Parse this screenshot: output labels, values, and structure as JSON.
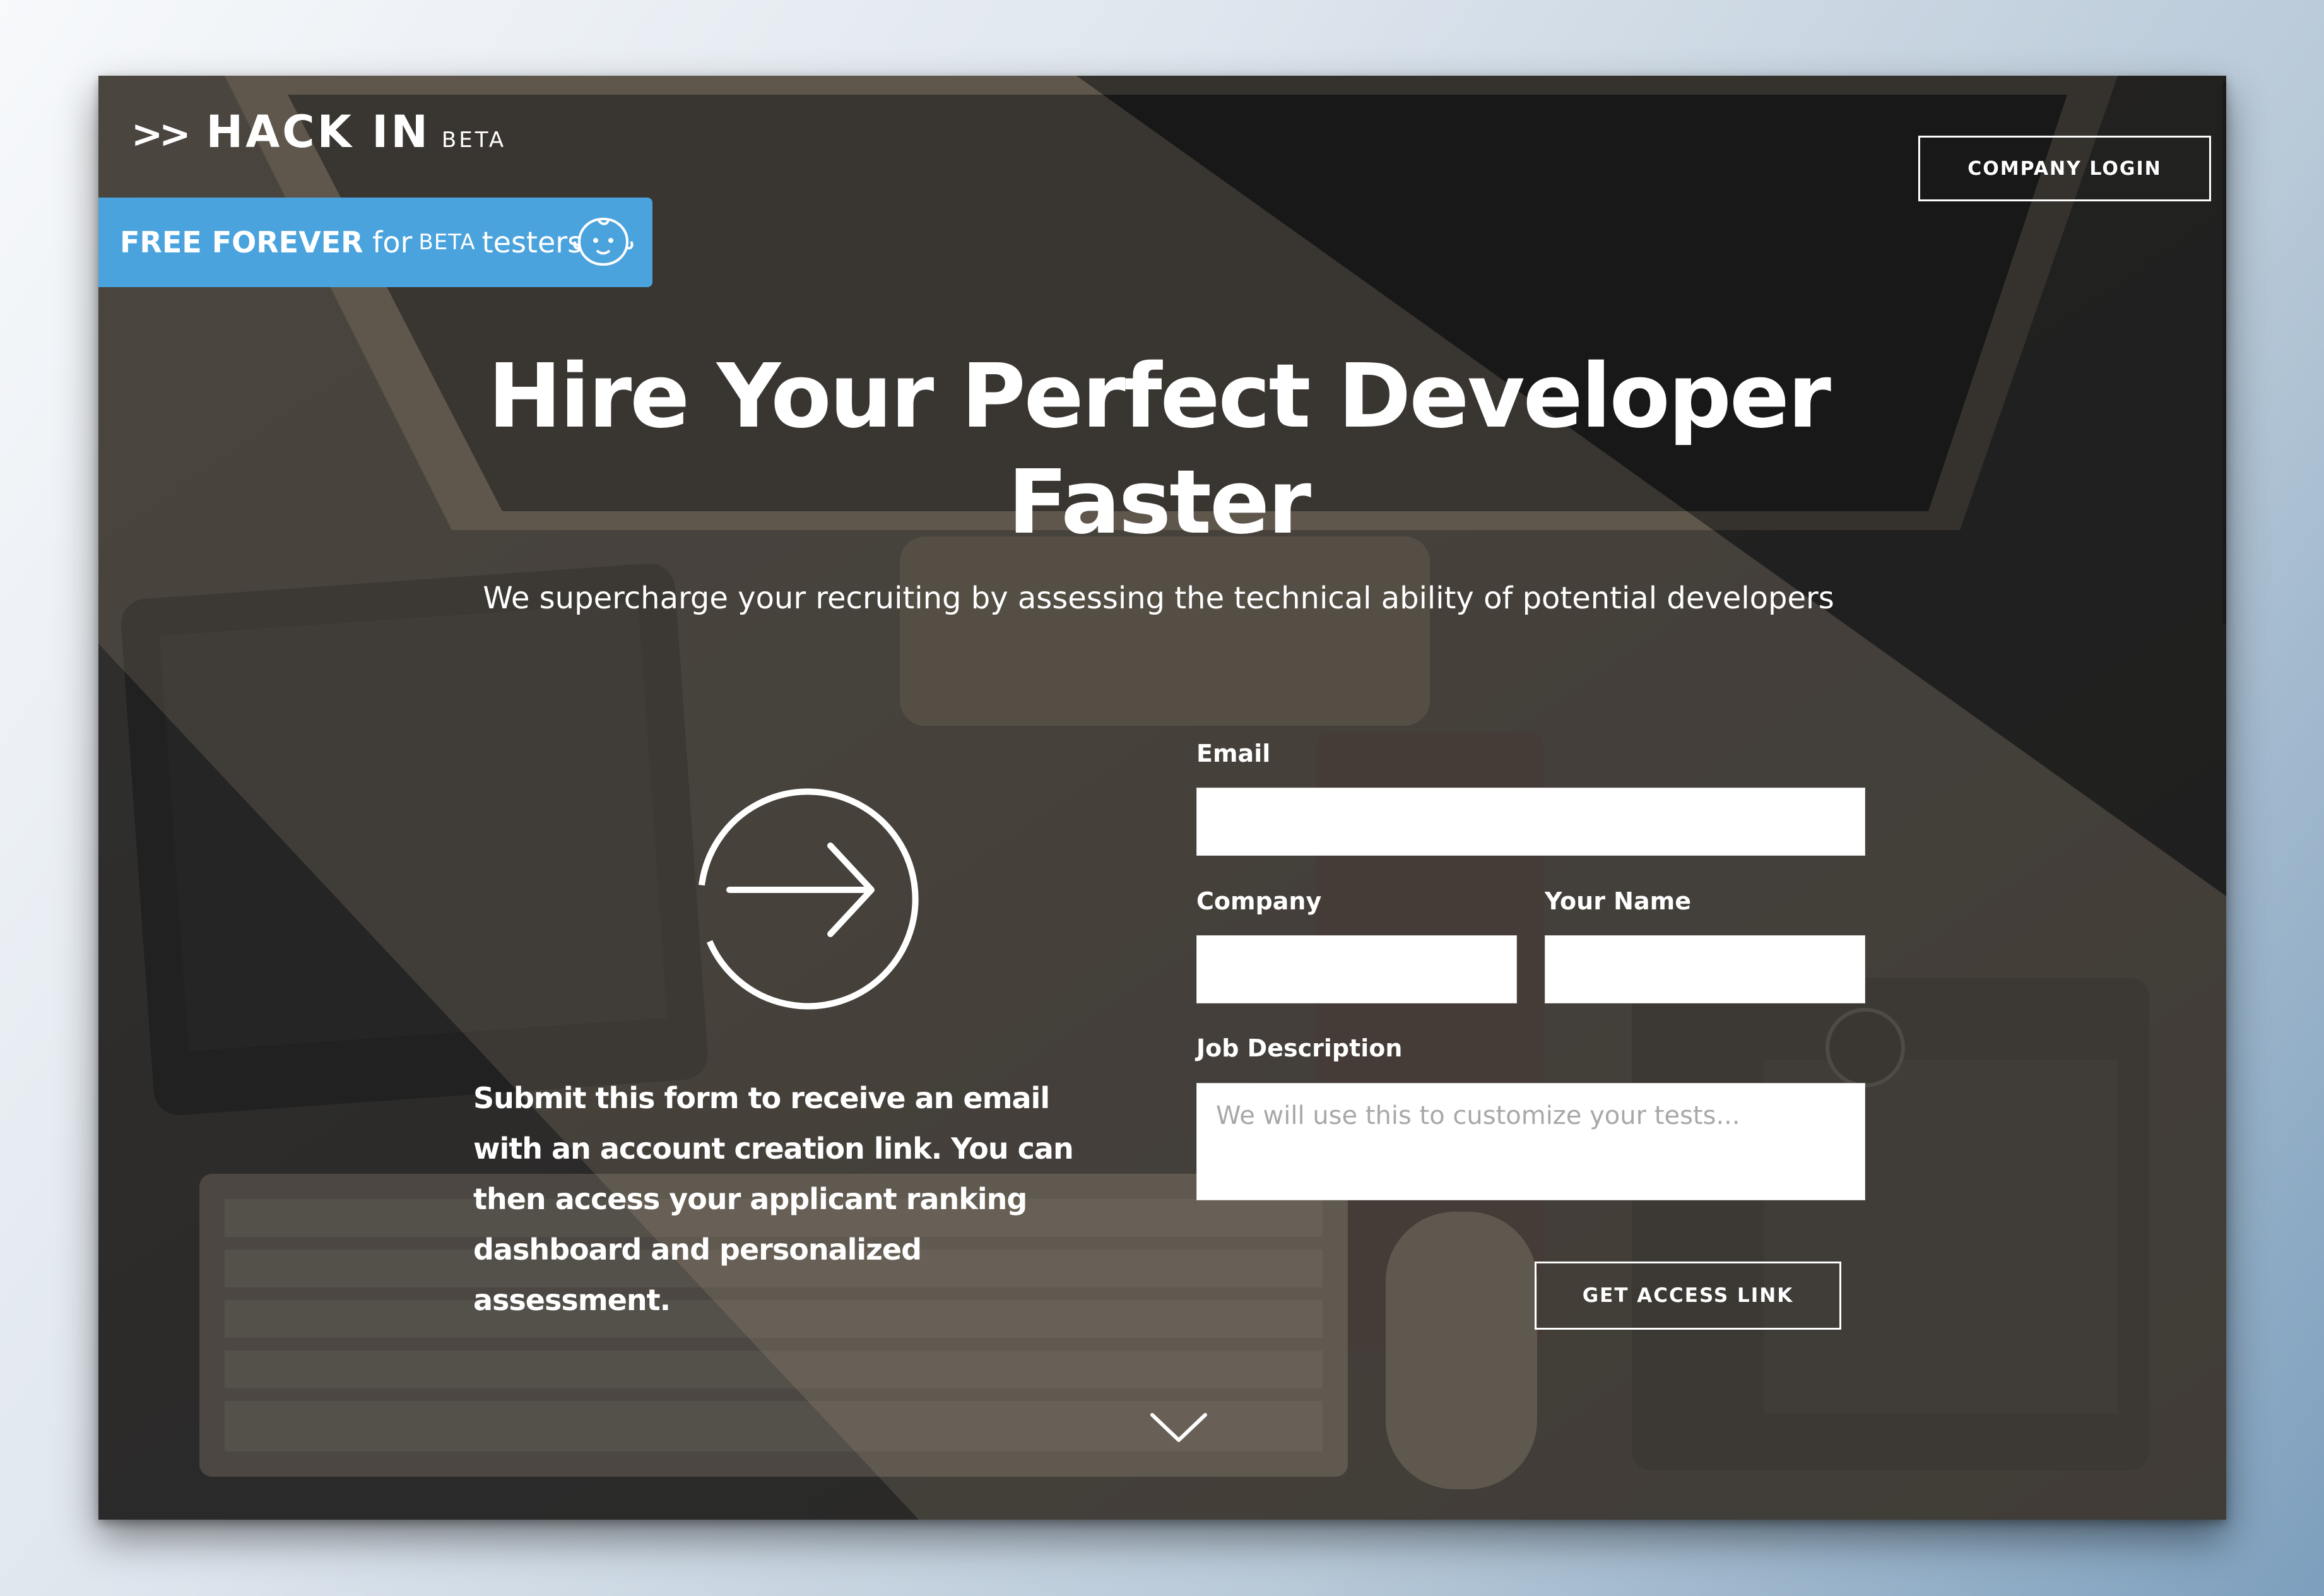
{
  "header": {
    "brand_chevrons": ">>",
    "brand_name": "HACK IN",
    "brand_tag": "BETA",
    "login_label": "COMPANY LOGIN"
  },
  "promo": {
    "strong": "FREE FOREVER",
    "for": "for",
    "beta": "BETA",
    "testers": "testers",
    "icon": "baby-face-icon"
  },
  "hero": {
    "title_line1": "Hire Your Perfect Developer",
    "title_line2": "Faster",
    "subtitle": "We supercharge your recruiting by assessing the technical ability of potential developers",
    "icon": "arrow-circle-icon"
  },
  "info_text": "Submit this form to receive an email with an account creation link. You can then access your applicant ranking dashboard and personalized assessment.",
  "form": {
    "email_label": "Email",
    "email_value": "",
    "company_label": "Company",
    "company_value": "",
    "name_label": "Your Name",
    "name_value": "",
    "job_label": "Job Description",
    "job_placeholder": "We will use this to customize your tests...",
    "submit_label": "GET ACCESS LINK"
  },
  "scroll_icon": "chevron-down-icon",
  "colors": {
    "promo_blue": "#4aa3dd",
    "text": "#ffffff",
    "overlay_dark": "#2e2e2e",
    "overlay_warm": "#7a6a58"
  }
}
